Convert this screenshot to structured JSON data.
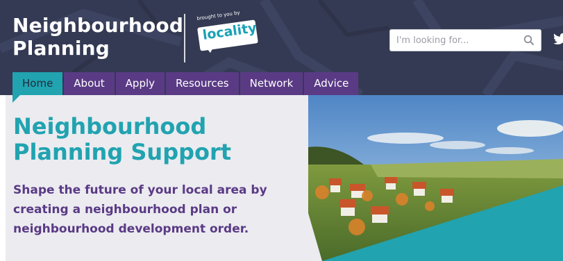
{
  "site": {
    "title_line1": "Neighbourhood",
    "title_line2": "Planning"
  },
  "partner": {
    "tagline": "brought to you by",
    "name": "locality"
  },
  "search": {
    "placeholder": "I'm looking for...",
    "icon": "search-icon"
  },
  "social": {
    "icon": "twitter-icon"
  },
  "nav": {
    "items": [
      {
        "label": "Home",
        "active": true
      },
      {
        "label": "About",
        "active": false
      },
      {
        "label": "Apply",
        "active": false
      },
      {
        "label": "Resources",
        "active": false
      },
      {
        "label": "Network",
        "active": false
      },
      {
        "label": "Advice",
        "active": false
      }
    ]
  },
  "hero": {
    "title_line1": "Neighbourhood",
    "title_line2": "Planning Support",
    "subtitle": "Shape the future of your local area by creating a neighbourhood plan or neighbourhood development order."
  },
  "colors": {
    "header_bg": "#343a53",
    "nav_purple": "#5a3a85",
    "teal": "#21a3b0",
    "hero_bg": "#ebebf0"
  }
}
